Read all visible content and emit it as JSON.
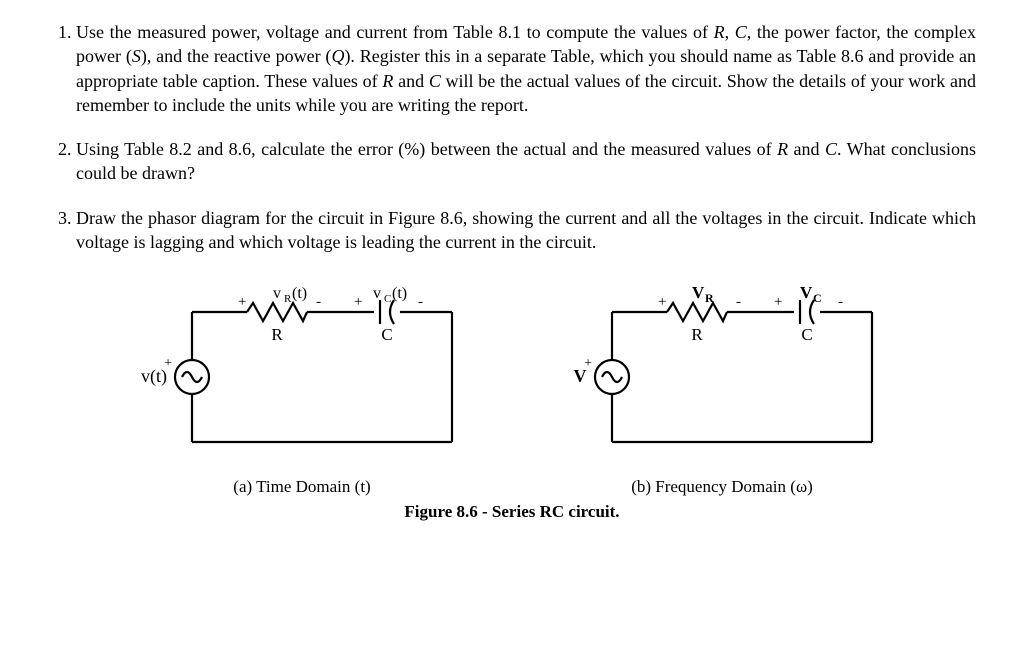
{
  "q1": "Use the measured power, voltage and current from Table 8.1 to compute the values of R, C, the power factor, the complex power (S), and the reactive power (Q). Register this in a separate Table, which you should name as Table 8.6 and provide an appropriate table caption. These values of R and C will be the actual values of the circuit. Show the details of your work and remember to include the units while you are writing the report.",
  "q2": "Using Table 8.2 and 8.6, calculate the error (%) between the actual and the measured values of R and C. What conclusions could be drawn?",
  "q3": "Draw the phasor diagram for the circuit in Figure 8.6, showing the current and all the voltages in the circuit. Indicate which voltage is lagging and which voltage is leading the current in the circuit.",
  "circuit_a": {
    "source_label": "v(t)",
    "vr_label_html": "v<sub>R</sub>(t)",
    "vc_label_html": "v<sub>C</sub>(t)",
    "r_label": "R",
    "c_label": "C",
    "sub_caption": "(a) Time Domain (t)"
  },
  "circuit_b": {
    "source_label": "V",
    "vr_label_html": "V<sub>R</sub>",
    "vc_label_html": "V<sub>C</sub>",
    "r_label": "R",
    "c_label": "C",
    "sub_caption": "(b) Frequency Domain (ω)"
  },
  "figure_caption": "Figure 8.6 - Series RC circuit."
}
